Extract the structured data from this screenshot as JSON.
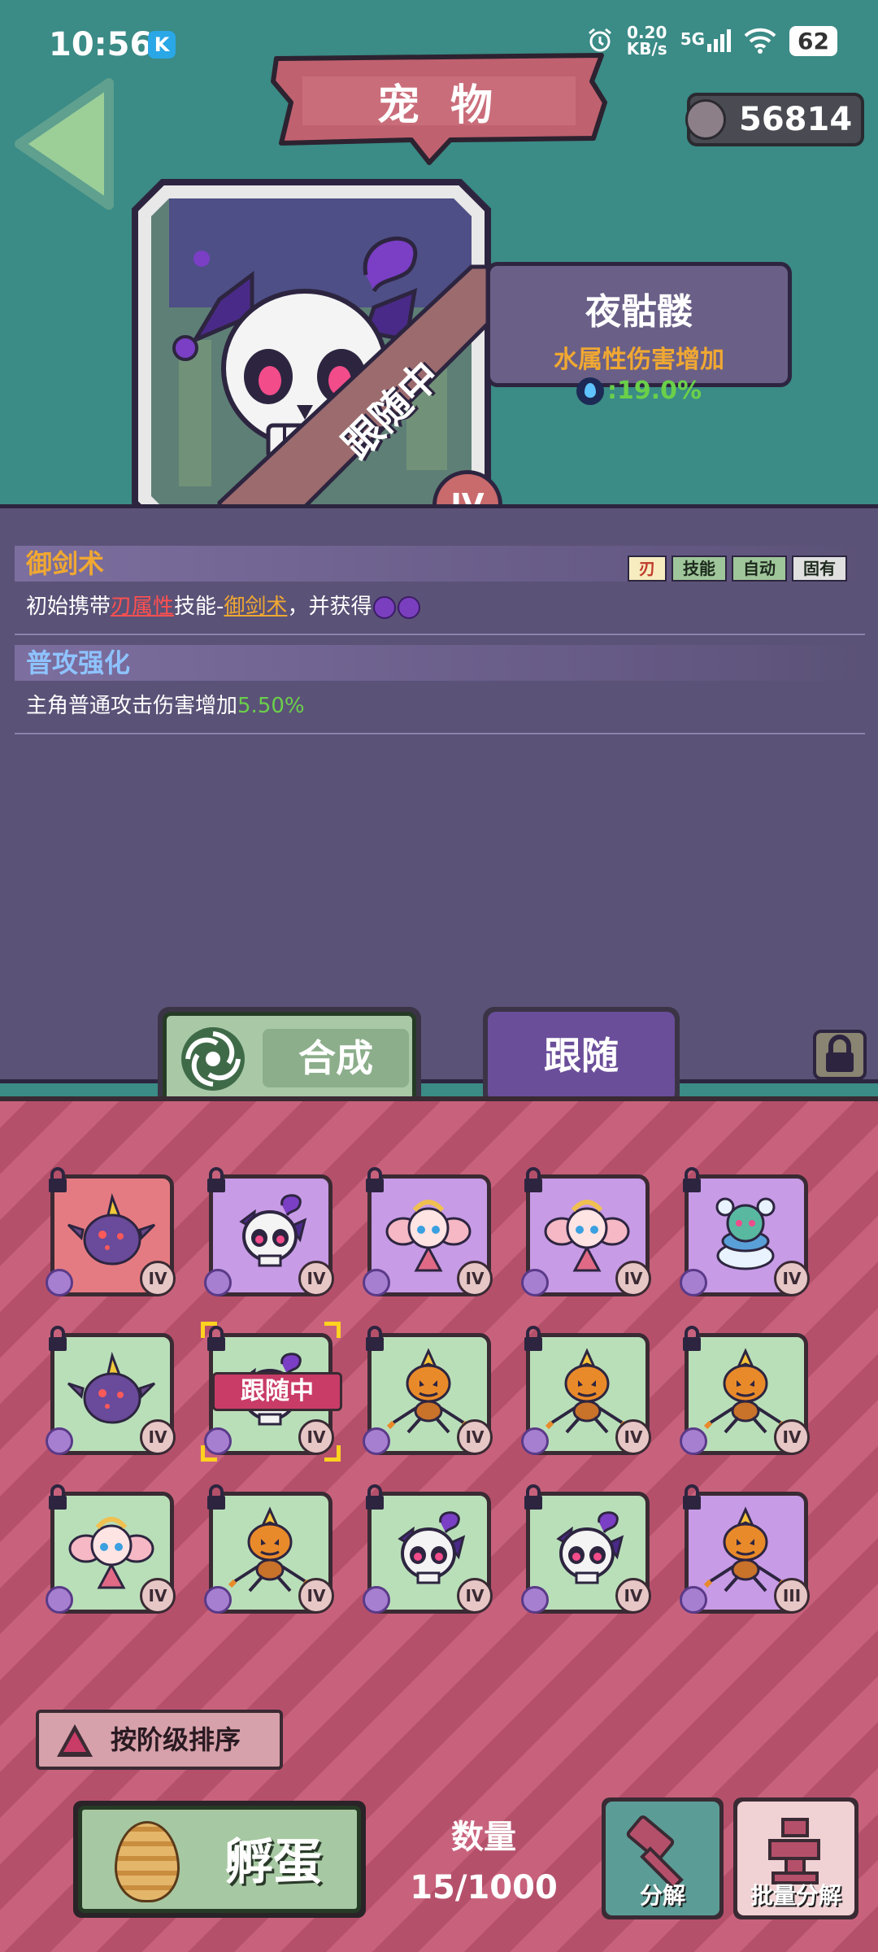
{
  "status_bar": {
    "time": "10:56",
    "app_badge": "K",
    "net_speed_value": "0.20",
    "net_speed_unit": "KB/s",
    "signal": "5G",
    "battery": "62"
  },
  "header": {
    "title": "宠 物",
    "currency_value": "56814",
    "back_icon": "back-arrow-icon"
  },
  "featured_pet": {
    "name": "夜骷髅",
    "effect": "水属性伤害增加",
    "effect_value": ":19.0%",
    "follow_label": "跟随中",
    "rank": "IV"
  },
  "skills": [
    {
      "title": "御剑术",
      "tags": [
        "刃",
        "技能",
        "自动",
        "固有"
      ],
      "desc_prefix": "初始携带",
      "desc_highlight_red": "刃属性",
      "desc_mid": "技能-",
      "desc_highlight_gold": "御剑术",
      "desc_suffix": "，并获得"
    },
    {
      "title": "普攻强化",
      "desc_prefix": "主角普通攻击伤害增加",
      "desc_value": "5.50%"
    }
  ],
  "actions": {
    "combine": "合成",
    "follow": "跟随"
  },
  "pets": [
    {
      "bg": "red",
      "kind": "eggplant",
      "rank": "IV"
    },
    {
      "bg": "purple",
      "kind": "skull",
      "rank": "IV"
    },
    {
      "bg": "purple",
      "kind": "fairy",
      "rank": "IV"
    },
    {
      "bg": "purple",
      "kind": "fairy",
      "rank": "IV"
    },
    {
      "bg": "purple",
      "kind": "snowman",
      "rank": "IV"
    },
    {
      "bg": "green",
      "kind": "eggplant",
      "rank": "IV"
    },
    {
      "bg": "green",
      "kind": "skull",
      "rank": "IV",
      "following": "跟随中",
      "selected": true
    },
    {
      "bg": "green",
      "kind": "pumpkin",
      "rank": "IV"
    },
    {
      "bg": "green",
      "kind": "pumpkin",
      "rank": "IV"
    },
    {
      "bg": "green",
      "kind": "pumpkin",
      "rank": "IV"
    },
    {
      "bg": "green",
      "kind": "fairy",
      "rank": "IV"
    },
    {
      "bg": "green",
      "kind": "pumpkin",
      "rank": "IV"
    },
    {
      "bg": "green",
      "kind": "skull",
      "rank": "IV"
    },
    {
      "bg": "green",
      "kind": "skull",
      "rank": "IV"
    },
    {
      "bg": "purple",
      "kind": "pumpkin",
      "rank": "III"
    }
  ],
  "footer": {
    "sort_label": "按阶级排序",
    "hatch_label": "孵蛋",
    "count_label": "数量",
    "count_value": "15/1000",
    "decompose_label": "分解",
    "batch_decompose_label": "批量分解"
  },
  "colors": {
    "teal_bg": "#3b8b86",
    "panel_purple": "#5b5277",
    "grid_pink": "#c8627c",
    "accent_orange": "#f0a832",
    "accent_green": "#6ad04a"
  }
}
